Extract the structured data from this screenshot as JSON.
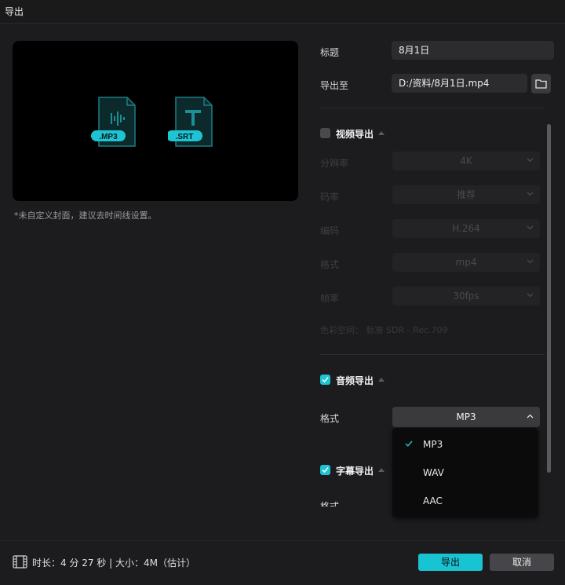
{
  "window": {
    "title": "导出"
  },
  "preview": {
    "icons": [
      {
        "name": "mp3-file-icon",
        "badge": ".MP3"
      },
      {
        "name": "srt-file-icon",
        "badge": ".SRT"
      }
    ],
    "cover_note": "*未自定义封面，建议去时间线设置。"
  },
  "form": {
    "title_label": "标题",
    "title_value": "8月1日",
    "export_to_label": "导出至",
    "export_to_value": "D:/资料/8月1日.mp4"
  },
  "video_export": {
    "label": "视频导出",
    "checked": false,
    "rows": [
      {
        "label": "分辨率",
        "value": "4K"
      },
      {
        "label": "码率",
        "value": "推荐"
      },
      {
        "label": "编码",
        "value": "H.264"
      },
      {
        "label": "格式",
        "value": "mp4"
      },
      {
        "label": "帧率",
        "value": "30fps"
      }
    ],
    "bitrate_info": "色彩空间：  标准 SDR - Rec.709"
  },
  "audio_export": {
    "label": "音频导出",
    "checked": true,
    "format_label": "格式",
    "format_value": "MP3",
    "options": [
      "MP3",
      "WAV",
      "AAC"
    ],
    "selected_option": "MP3"
  },
  "subtitle_export": {
    "label": "字幕导出",
    "checked": true,
    "format_label": "格式"
  },
  "footer": {
    "duration_text": "时长：4 分 27 秒 | 大小：4M（估计）",
    "export_button": "导出",
    "cancel_button": "取消"
  },
  "colors": {
    "accent": "#1fc4d4",
    "background": "#1c1c1e",
    "field": "#2c2c2e"
  }
}
